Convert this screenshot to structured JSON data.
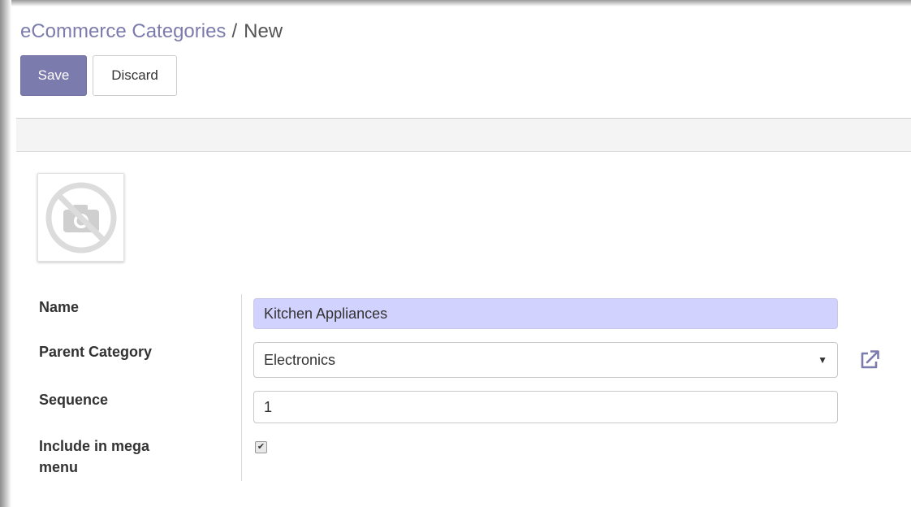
{
  "breadcrumb": {
    "parent": "eCommerce Categories",
    "separator": "/",
    "current": "New"
  },
  "toolbar": {
    "save_label": "Save",
    "discard_label": "Discard"
  },
  "image_field": {
    "icon": "no-photo-icon"
  },
  "form": {
    "name": {
      "label": "Name",
      "value": "Kitchen Appliances"
    },
    "parent_category": {
      "label": "Parent Category",
      "value": "Electronics",
      "caret": "▼"
    },
    "sequence": {
      "label": "Sequence",
      "value": "1"
    },
    "mega_menu": {
      "label_line1": "Include in mega",
      "label_line2": "menu",
      "checked": true,
      "check_glyph": "✔"
    }
  },
  "colors": {
    "brand": "#7c7bad",
    "name_field_bg": "#d2d2ff",
    "link_icon": "#7c7bad"
  }
}
